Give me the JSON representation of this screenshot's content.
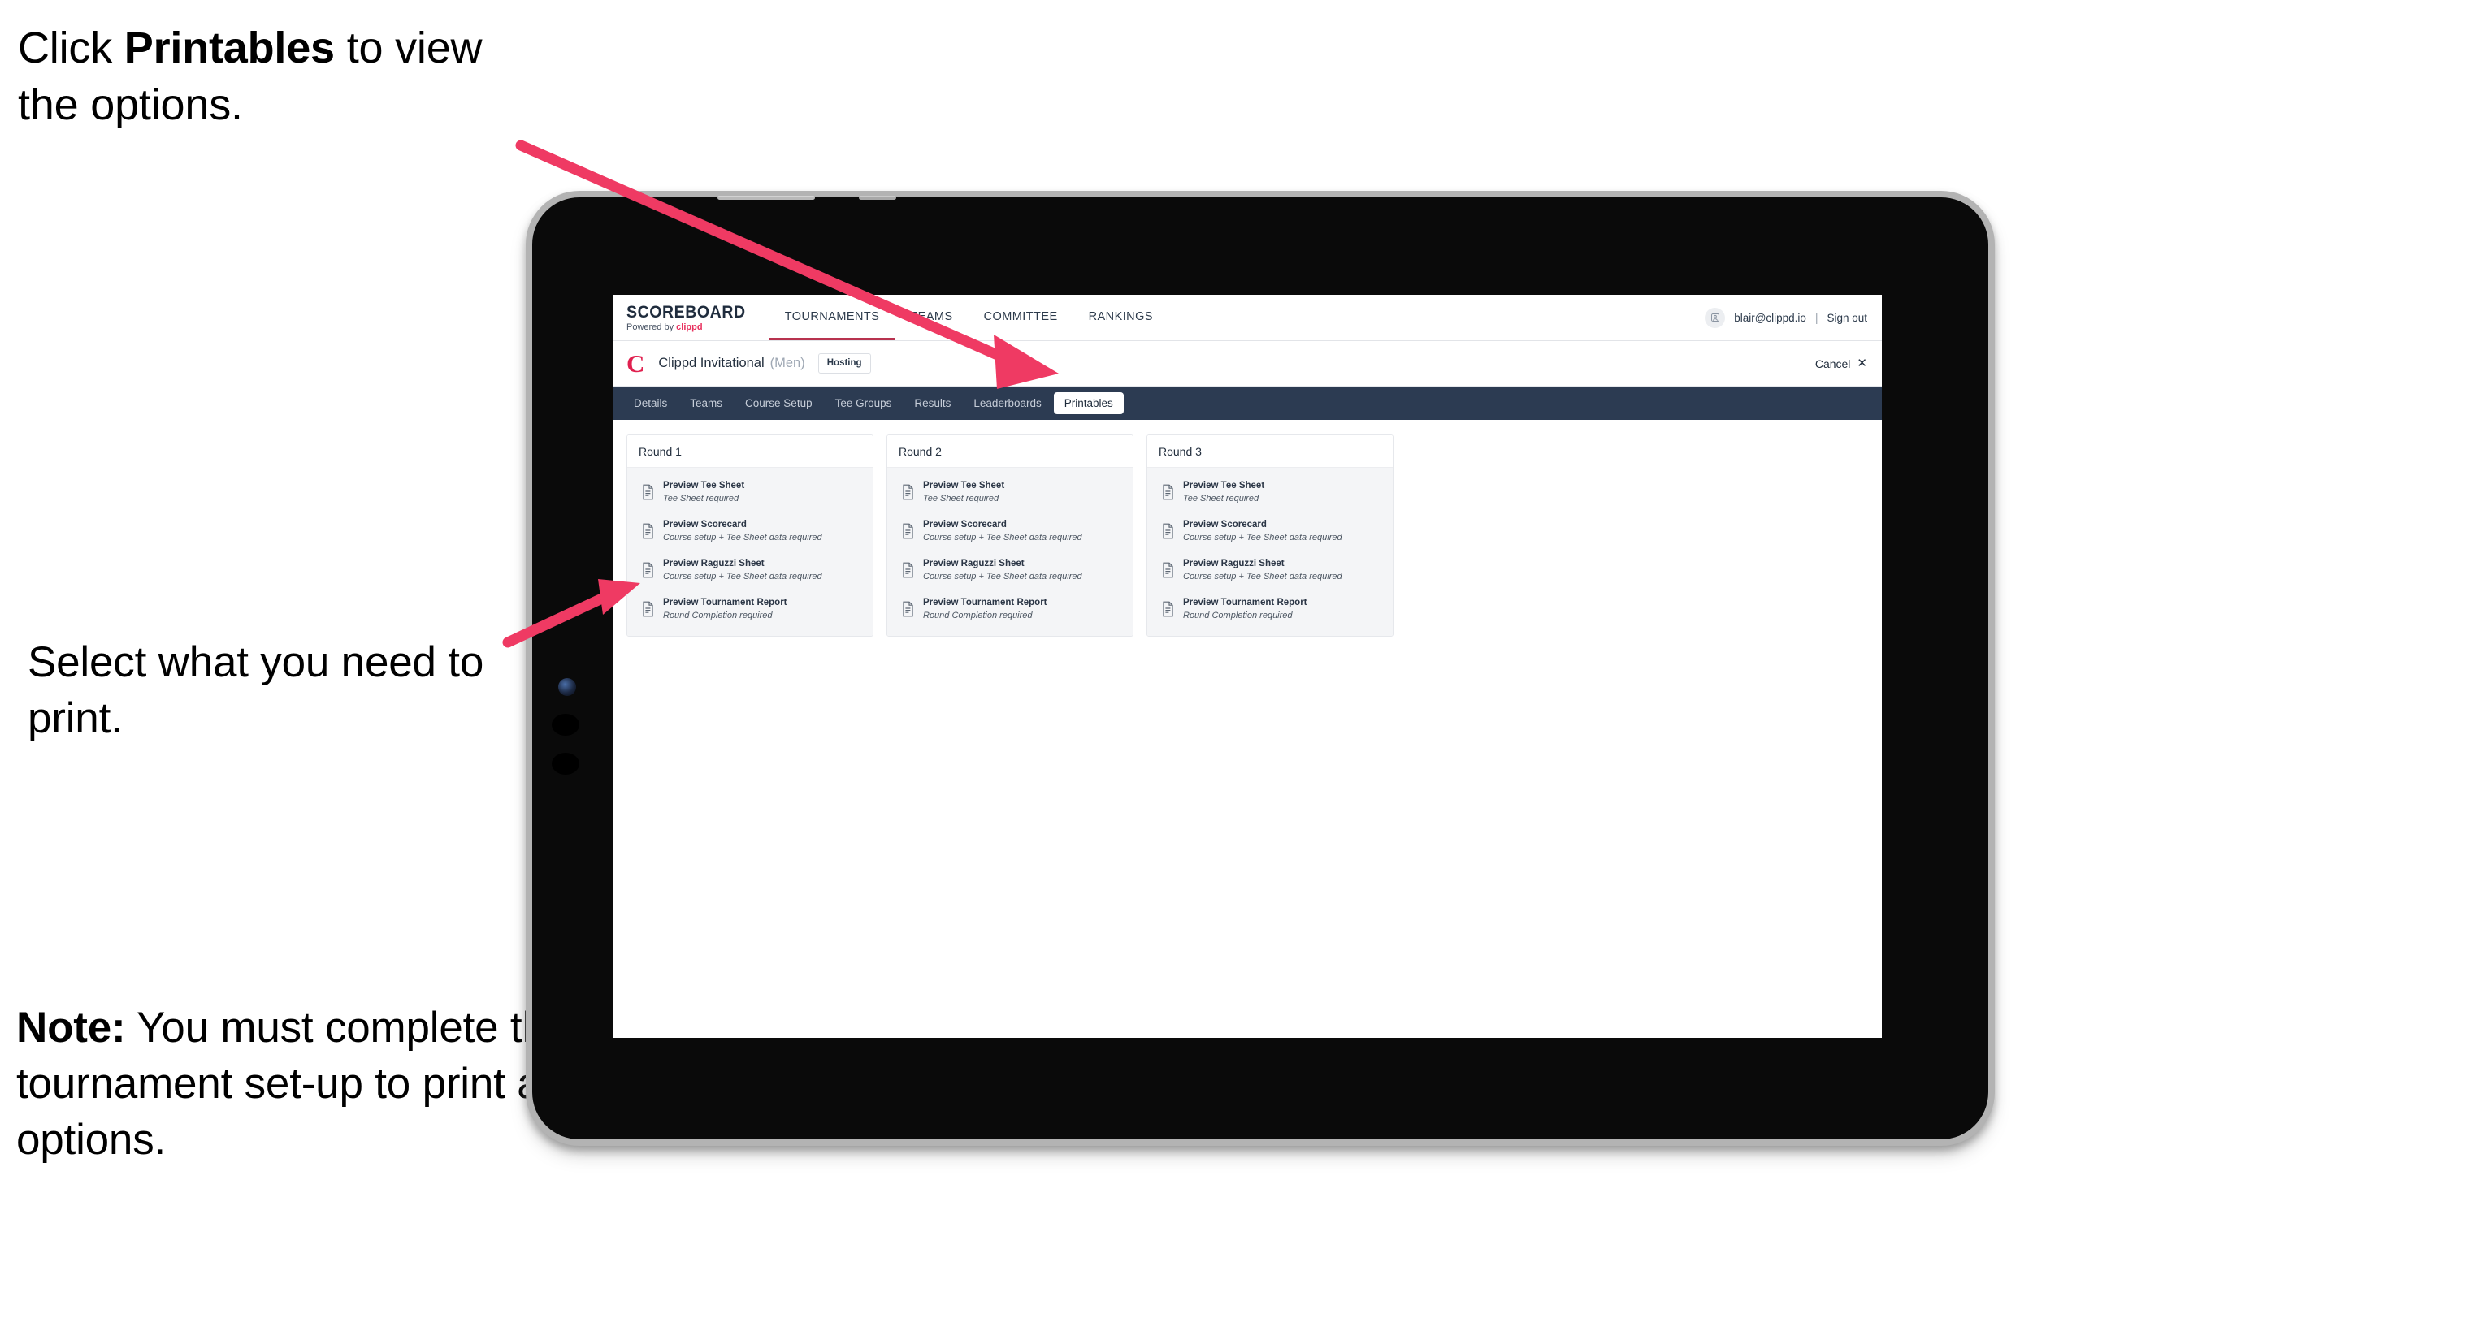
{
  "annotations": {
    "click_prefix": "Click ",
    "click_bold": "Printables",
    "click_suffix": " to view the options.",
    "select": "Select what you need to print.",
    "note_bold": "Note:",
    "note_rest": " You must complete the tournament set-up to print all the options.",
    "arrow_color": "#ef3a63"
  },
  "app": {
    "brand": {
      "main": "SCOREBOARD",
      "sub_prefix": "Powered by ",
      "sub_brand": "clippd"
    },
    "topnav": [
      {
        "label": "TOURNAMENTS",
        "active": true
      },
      {
        "label": "TEAMS",
        "active": false
      },
      {
        "label": "COMMITTEE",
        "active": false
      },
      {
        "label": "RANKINGS",
        "active": false
      }
    ],
    "user": {
      "avatar_icon": "user-avatar-icon",
      "email": "blair@clippd.io",
      "separator": "|",
      "signout": "Sign out"
    },
    "tournament": {
      "logo_letter": "C",
      "name": "Clippd Invitational",
      "gender": "(Men)",
      "badge": "Hosting",
      "cancel_label": "Cancel",
      "cancel_icon": "close-x-icon"
    },
    "subtabs": [
      {
        "label": "Details",
        "active": false
      },
      {
        "label": "Teams",
        "active": false
      },
      {
        "label": "Course Setup",
        "active": false
      },
      {
        "label": "Tee Groups",
        "active": false
      },
      {
        "label": "Results",
        "active": false
      },
      {
        "label": "Leaderboards",
        "active": false
      },
      {
        "label": "Printables",
        "active": true
      }
    ],
    "rounds": [
      {
        "title": "Round 1",
        "items": [
          {
            "title": "Preview Tee Sheet",
            "sub": "Tee Sheet required",
            "icon": "document-icon"
          },
          {
            "title": "Preview Scorecard",
            "sub": "Course setup + Tee Sheet data required",
            "icon": "document-icon"
          },
          {
            "title": "Preview Raguzzi Sheet",
            "sub": "Course setup + Tee Sheet data required",
            "icon": "document-icon"
          },
          {
            "title": "Preview Tournament Report",
            "sub": "Round Completion required",
            "icon": "document-icon"
          }
        ]
      },
      {
        "title": "Round 2",
        "items": [
          {
            "title": "Preview Tee Sheet",
            "sub": "Tee Sheet required",
            "icon": "document-icon"
          },
          {
            "title": "Preview Scorecard",
            "sub": "Course setup + Tee Sheet data required",
            "icon": "document-icon"
          },
          {
            "title": "Preview Raguzzi Sheet",
            "sub": "Course setup + Tee Sheet data required",
            "icon": "document-icon"
          },
          {
            "title": "Preview Tournament Report",
            "sub": "Round Completion required",
            "icon": "document-icon"
          }
        ]
      },
      {
        "title": "Round 3",
        "items": [
          {
            "title": "Preview Tee Sheet",
            "sub": "Tee Sheet required",
            "icon": "document-icon"
          },
          {
            "title": "Preview Scorecard",
            "sub": "Course setup + Tee Sheet data required",
            "icon": "document-icon"
          },
          {
            "title": "Preview Raguzzi Sheet",
            "sub": "Course setup + Tee Sheet data required",
            "icon": "document-icon"
          },
          {
            "title": "Preview Tournament Report",
            "sub": "Round Completion required",
            "icon": "document-icon"
          }
        ]
      }
    ]
  },
  "colors": {
    "accent_pink": "#e0204f",
    "nav_dark": "#2c3b52",
    "active_underline": "#b8324f"
  }
}
